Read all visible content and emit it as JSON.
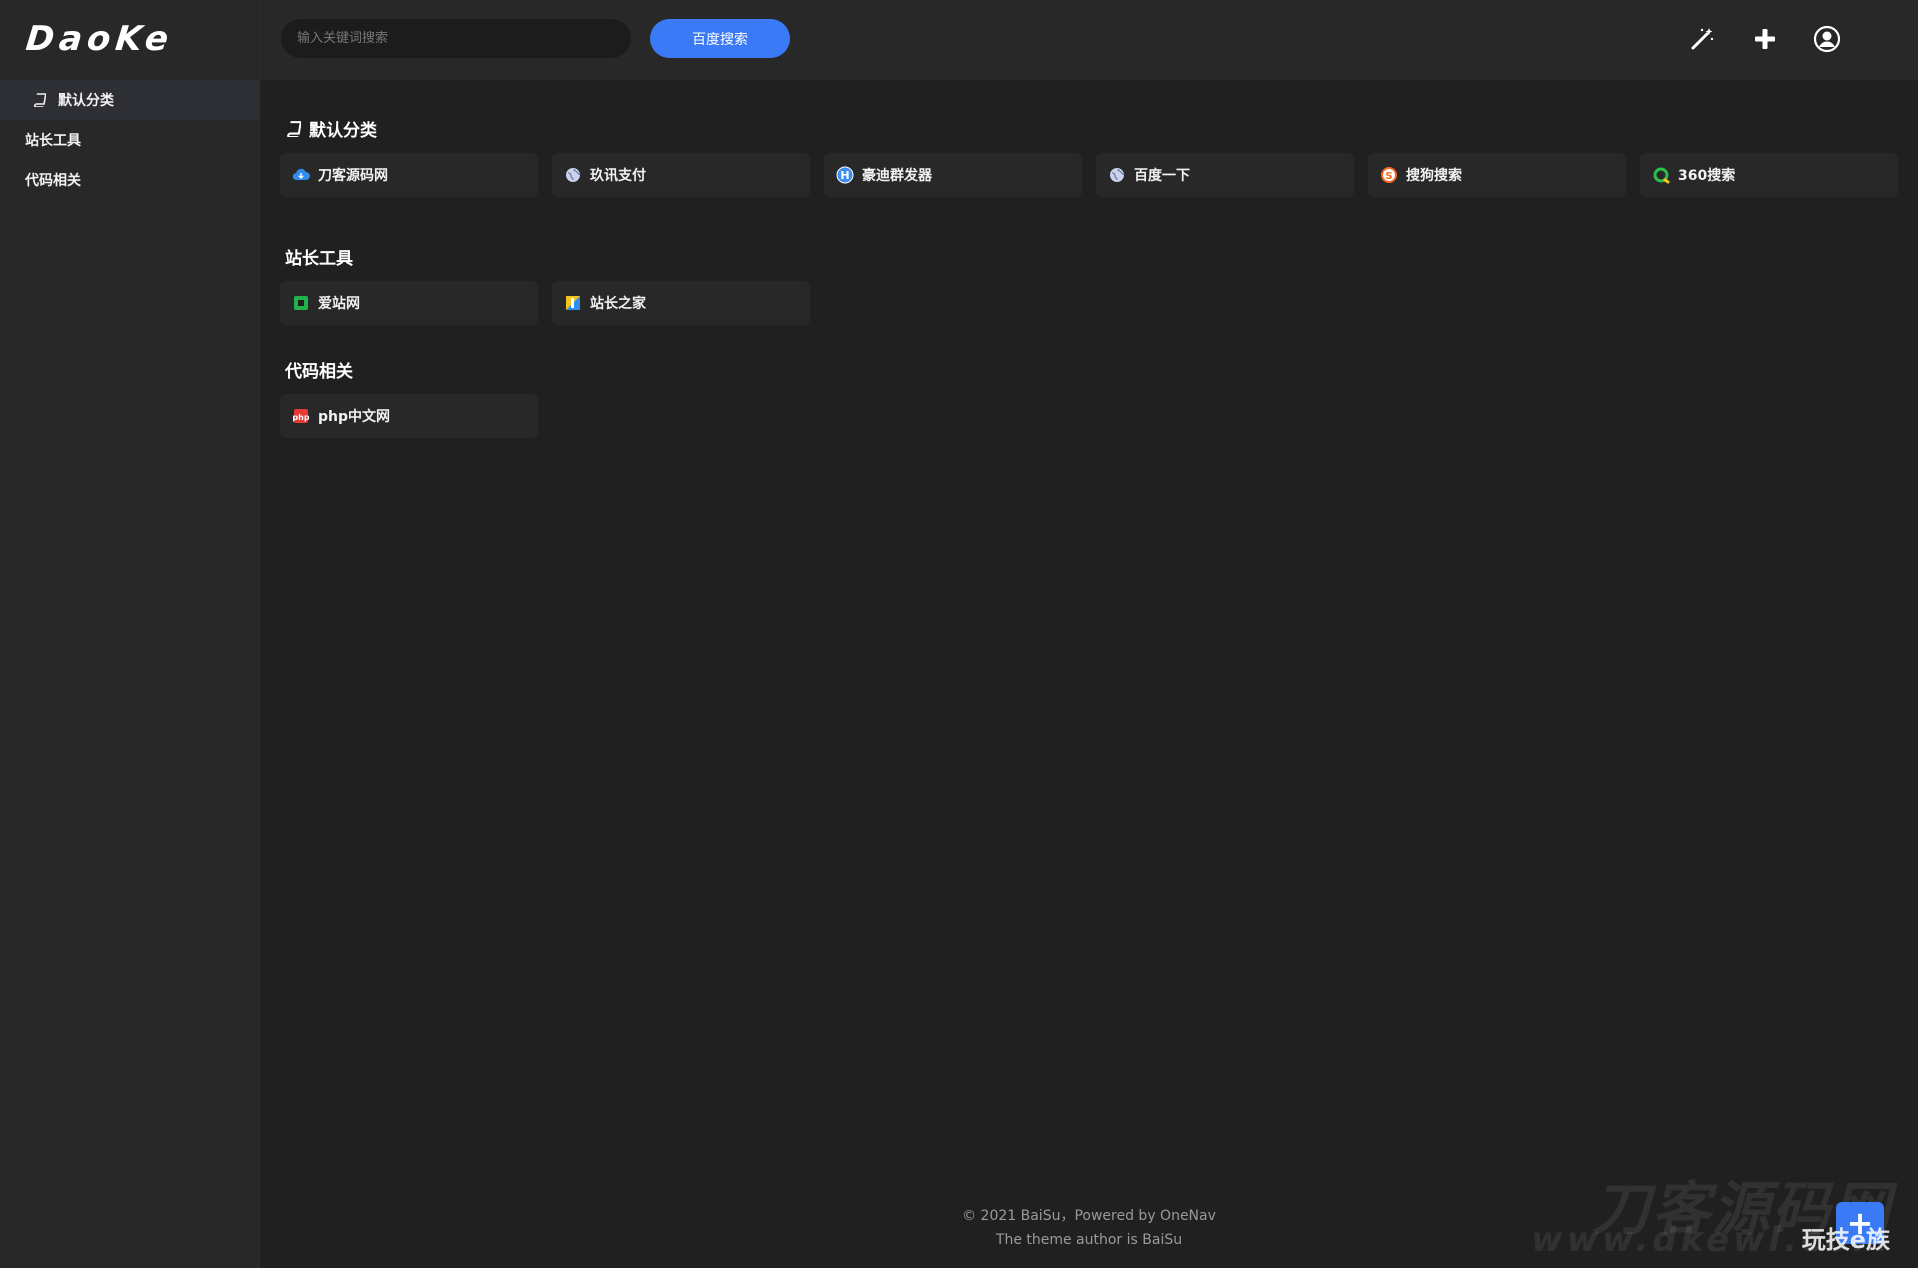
{
  "app": {
    "logo": "DaoKe"
  },
  "sidebar": {
    "items": [
      {
        "label": "默认分类",
        "icon": "book-icon",
        "active": true
      },
      {
        "label": "站长工具",
        "active": false
      },
      {
        "label": "代码相关",
        "active": false
      }
    ]
  },
  "header": {
    "search_placeholder": "输入关键词搜索",
    "search_button": "百度搜索",
    "icons": [
      "magic-wand-icon",
      "plus-icon",
      "user-circle-icon"
    ]
  },
  "categories": [
    {
      "title": "默认分类",
      "icon": "book-icon",
      "links": [
        {
          "label": "刀客源码网",
          "icon": "cloud-icon",
          "color": "#2f8df0"
        },
        {
          "label": "玖讯支付",
          "icon": "globe-icon",
          "color": "#9aa6c8"
        },
        {
          "label": "豪迪群发器",
          "icon": "h-badge-icon",
          "color": "#3b8ff0"
        },
        {
          "label": "百度一下",
          "icon": "globe-icon",
          "color": "#9aa6c8"
        },
        {
          "label": "搜狗搜索",
          "icon": "sogou-icon",
          "color": "#f5681f"
        },
        {
          "label": "360搜索",
          "icon": "360-icon",
          "color": "#2dbf4a"
        }
      ]
    },
    {
      "title": "站长工具",
      "links": [
        {
          "label": "爱站网",
          "icon": "aizhan-icon",
          "color": "#22b24c"
        },
        {
          "label": "站长之家",
          "icon": "chinaz-icon",
          "color": "#f3c21b"
        }
      ]
    },
    {
      "title": "代码相关",
      "links": [
        {
          "label": "php中文网",
          "icon": "php-icon",
          "color": "#e53935"
        }
      ]
    }
  ],
  "footer": {
    "line1": "© 2021 BaiSu，Powered by OneNav",
    "line2": "The theme author is BaiSu"
  },
  "watermark": {
    "title": "刀客源码网",
    "url": "www.dkewl.com",
    "tag": "玩技e族"
  },
  "colors": {
    "accent": "#3b7af7",
    "background": "#202020",
    "panel": "#282828"
  }
}
